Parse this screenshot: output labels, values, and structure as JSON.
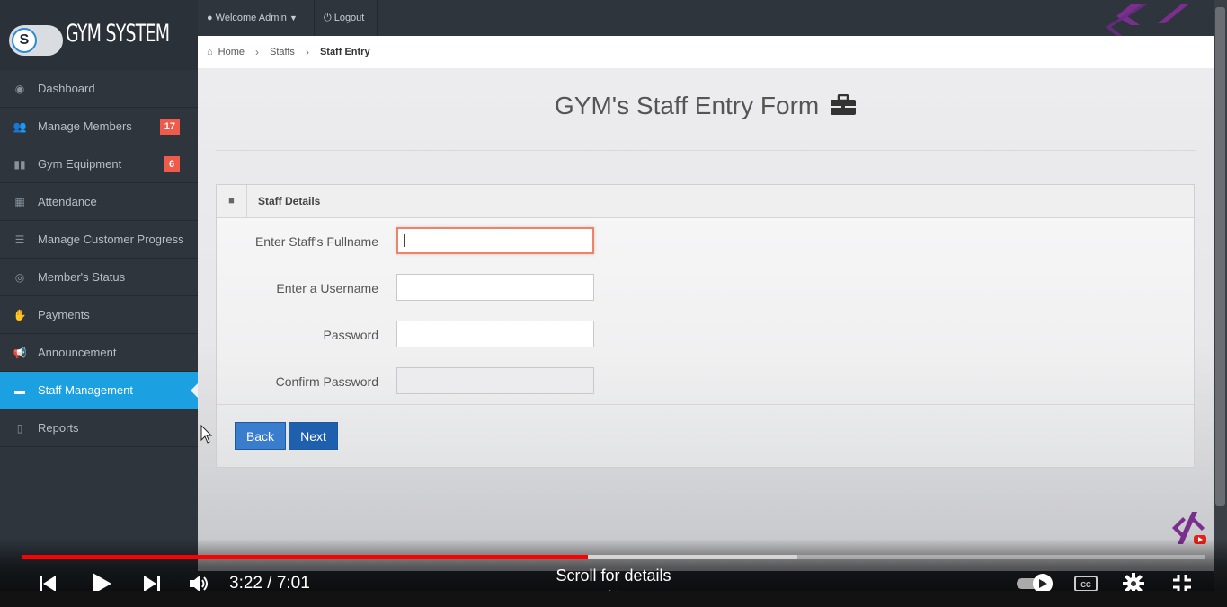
{
  "brand": {
    "name": "GYM SYSTEM",
    "logo_letter": "S"
  },
  "sidebar": {
    "items": [
      {
        "label": "Dashboard",
        "icon": "dashboard-icon",
        "glyph": "◉",
        "badge": ""
      },
      {
        "label": "Manage Members",
        "icon": "users-icon",
        "glyph": "👥",
        "badge": "17"
      },
      {
        "label": "Gym Equipment",
        "icon": "dumbbell-icon",
        "glyph": "▮▮",
        "badge": "6"
      },
      {
        "label": "Attendance",
        "icon": "calendar-icon",
        "glyph": "▦",
        "badge": ""
      },
      {
        "label": "Manage Customer Progress",
        "icon": "list-icon",
        "glyph": "☰",
        "badge": ""
      },
      {
        "label": "Member's Status",
        "icon": "eye-icon",
        "glyph": "◎",
        "badge": ""
      },
      {
        "label": "Payments",
        "icon": "hand-money-icon",
        "glyph": "✋",
        "badge": ""
      },
      {
        "label": "Announcement",
        "icon": "megaphone-icon",
        "glyph": "📢",
        "badge": ""
      },
      {
        "label": "Staff Management",
        "icon": "briefcase-icon",
        "glyph": "▬",
        "badge": "",
        "active": true
      },
      {
        "label": "Reports",
        "icon": "file-icon",
        "glyph": "▯",
        "badge": ""
      }
    ]
  },
  "topbar": {
    "welcome": "Welcome Admin",
    "logout": "Logout"
  },
  "breadcrumb": {
    "home": "Home",
    "staffs": "Staffs",
    "current": "Staff Entry"
  },
  "page": {
    "title": "GYM's Staff Entry Form"
  },
  "panel": {
    "title": "Staff Details"
  },
  "form": {
    "fullname_label": "Enter Staff's Fullname",
    "fullname_value": "",
    "username_label": "Enter a Username",
    "username_value": "",
    "password_label": "Password",
    "password_value": "",
    "confirm_label": "Confirm Password",
    "confirm_value": ""
  },
  "buttons": {
    "back": "Back",
    "next": "Next"
  },
  "video": {
    "time": "3:22 / 7:01",
    "scroll_hint": "Scroll for details",
    "played_fraction": 0.4787,
    "buffered_fraction": 0.655
  },
  "colors": {
    "accent": "#1ba1e2",
    "badge": "#f05a4a",
    "progress": "#ff0000",
    "button": "#3a7dcc"
  }
}
